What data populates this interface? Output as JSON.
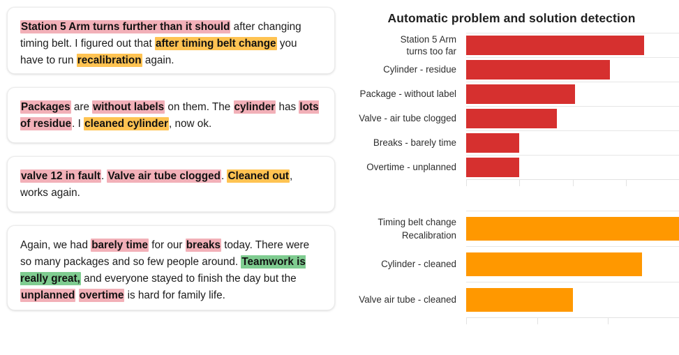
{
  "notes": [
    {
      "id": "note-1",
      "segments": [
        {
          "text": "Station 5 Arm turns further than it should",
          "style": "problem"
        },
        {
          "text": " after changing timing belt. I figured out that ",
          "style": "plain"
        },
        {
          "text": "after timing belt change",
          "style": "solution"
        },
        {
          "text": " you have to run ",
          "style": "plain"
        },
        {
          "text": "recalibration",
          "style": "solution"
        },
        {
          "text": " again.",
          "style": "plain"
        }
      ]
    },
    {
      "id": "note-2",
      "segments": [
        {
          "text": "Packages",
          "style": "problem"
        },
        {
          "text": " are ",
          "style": "plain"
        },
        {
          "text": "without labels",
          "style": "problem"
        },
        {
          "text": " on them. The ",
          "style": "plain"
        },
        {
          "text": "cylinder",
          "style": "problem"
        },
        {
          "text": " has ",
          "style": "plain"
        },
        {
          "text": "lots of residue",
          "style": "problem"
        },
        {
          "text": ". I ",
          "style": "plain"
        },
        {
          "text": "cleaned cylinder",
          "style": "solution"
        },
        {
          "text": ", now ok.",
          "style": "plain"
        }
      ]
    },
    {
      "id": "note-3",
      "segments": [
        {
          "text": "valve 12 in fault",
          "style": "problem"
        },
        {
          "text": ". ",
          "style": "plain"
        },
        {
          "text": "Valve air tube clogged",
          "style": "problem"
        },
        {
          "text": ". ",
          "style": "plain"
        },
        {
          "text": "Cleaned out",
          "style": "solution"
        },
        {
          "text": ", works again.",
          "style": "plain"
        }
      ]
    },
    {
      "id": "note-4",
      "segments": [
        {
          "text": "Again, we had ",
          "style": "plain"
        },
        {
          "text": "barely time",
          "style": "problem"
        },
        {
          "text": " for our ",
          "style": "plain"
        },
        {
          "text": "breaks",
          "style": "problem"
        },
        {
          "text": " today. There were so many packages and so few people around. ",
          "style": "plain"
        },
        {
          "text": "Teamwork is really great,",
          "style": "positive"
        },
        {
          "text": " and everyone stayed to finish the day but the ",
          "style": "plain"
        },
        {
          "text": "unplanned",
          "style": "problem"
        },
        {
          "text": " ",
          "style": "plain"
        },
        {
          "text": "overtime",
          "style": "problem"
        },
        {
          "text": " is hard for family life.",
          "style": "plain"
        }
      ]
    }
  ],
  "charts": {
    "title": "Automatic problem and solution detection"
  },
  "colors": {
    "problem_bar": "#d6302f",
    "solution_bar": "#ff9800",
    "problem_highlight": "#f2b0b8",
    "solution_highlight": "#ffc352",
    "positive_highlight": "#7fcc90"
  },
  "chart_data": [
    {
      "type": "bar",
      "orientation": "horizontal",
      "id": "problems",
      "title": "Automatic problem and solution detection",
      "xlabel": "",
      "ylabel": "",
      "grid": true,
      "legend": "none",
      "color": "#d6302f",
      "xlim": [
        0,
        4
      ],
      "xticks": [
        0,
        1,
        2,
        3,
        4
      ],
      "xticklabels": [
        "",
        "",
        "",
        "",
        ""
      ],
      "categories": [
        "Station 5 Arm\nturns too far",
        "Cylinder - residue",
        "Package - without label",
        "Valve - air tube clogged",
        "Breaks - barely time",
        "Overtime - unplanned"
      ],
      "values": [
        3.35,
        2.7,
        2.05,
        1.7,
        1.0,
        1.0
      ]
    },
    {
      "type": "bar",
      "orientation": "horizontal",
      "id": "solutions",
      "title": "",
      "xlabel": "",
      "ylabel": "",
      "grid": true,
      "legend": "none",
      "color": "#ff9800",
      "xlim": [
        0,
        3
      ],
      "xticks": [
        0,
        1,
        2,
        3
      ],
      "xticklabels": [
        "",
        "",
        "",
        ""
      ],
      "categories": [
        "Timing belt change\nRecalibration",
        "Cylinder - cleaned",
        "Valve air tube - cleaned"
      ],
      "values": [
        3.0,
        2.48,
        1.5
      ]
    }
  ]
}
